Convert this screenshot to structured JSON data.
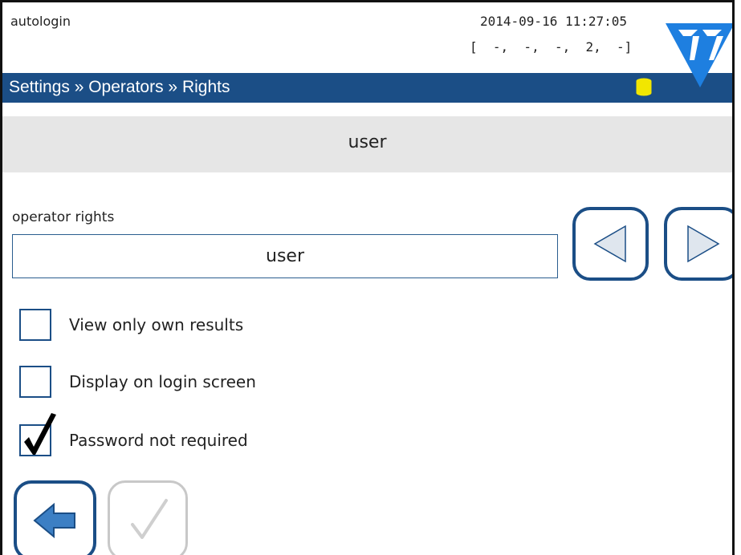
{
  "status": {
    "user": "autologin",
    "datetime": "2014-09-16 11:27:05",
    "codes": "[  -,  -,  -,  2,  -]"
  },
  "breadcrumb": "Settings » Operators » Rights",
  "title": "user",
  "operator_rights": {
    "label": "operator rights",
    "value": "user"
  },
  "options": [
    {
      "label": "View only own results",
      "checked": false
    },
    {
      "label": "Display on login screen",
      "checked": false
    },
    {
      "label": "Password not required",
      "checked": true
    }
  ],
  "icons": {
    "database": "database-icon",
    "logo": "logo-icon",
    "prev": "triangle-left-icon",
    "next": "triangle-right-icon",
    "back": "arrow-left-icon",
    "confirm": "checkmark-icon"
  },
  "colors": {
    "accent": "#1b4e86",
    "database": "#f2e600",
    "logo": "#1e7fe0",
    "title_band": "#e6e6e6",
    "disabled": "#c8c8c8"
  }
}
